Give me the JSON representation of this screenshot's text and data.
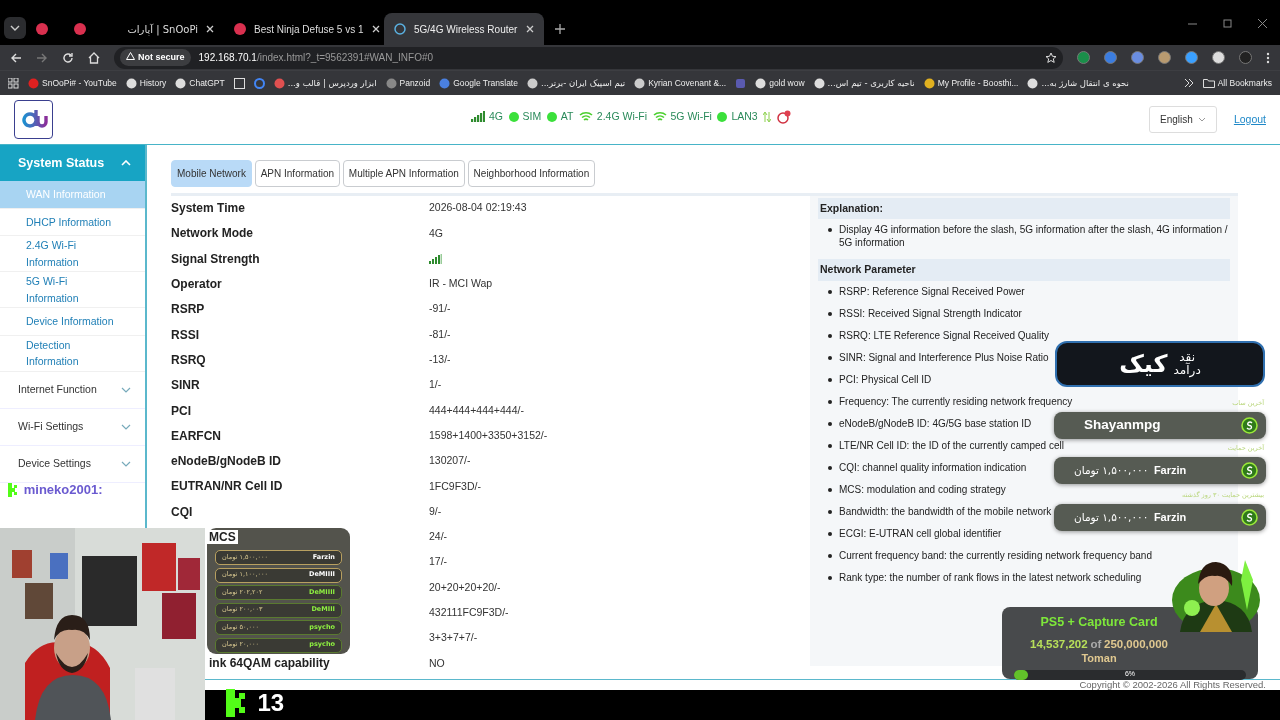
{
  "browser": {
    "tabs": [
      {
        "title": "SnOoPi | آپارات",
        "selected": false
      },
      {
        "title": "Best Ninja Defuse 5 vs 1",
        "selected": false
      },
      {
        "title": "5G/4G Wireless Router",
        "selected": true
      }
    ],
    "security": "Not secure",
    "url_host": "192.168.70.1",
    "url_path": "/index.html?_t=9562391#WAN_INFO#0",
    "bookmarks": [
      "SnOoPi# - YouTube",
      "History",
      "ChatGPT",
      "ابزار وردپرس | قالب و...",
      "Panzoid",
      "Google Translate",
      "تیم اسپیک ایران -برتر...",
      "Kyrian Covenant &...",
      "gold wow",
      "ناحیه کاربری - تیم اس...",
      "My Profile - Boosthi...",
      "نحوه ی انتقال شارژ به..."
    ],
    "all_bookmarks": "All Bookmarks"
  },
  "router": {
    "status": [
      {
        "kind": "signal",
        "label": "4G"
      },
      {
        "kind": "dot",
        "label": "SIM"
      },
      {
        "kind": "dot",
        "label": "AT"
      },
      {
        "kind": "wifi",
        "label": "2.4G Wi-Fi"
      },
      {
        "kind": "wifi",
        "label": "5G Wi-Fi"
      },
      {
        "kind": "dot",
        "label": "LAN3"
      }
    ],
    "language": "English",
    "logout": "Logout",
    "sidebar": [
      {
        "label": "System Status",
        "expanded": true,
        "children": [
          {
            "label": "WAN Information",
            "selected": true
          },
          {
            "label": "DHCP Information",
            "selected": false
          },
          {
            "label": "2.4G Wi-Fi Information",
            "selected": false
          },
          {
            "label": "5G Wi-Fi Information",
            "selected": false
          },
          {
            "label": "Device Information",
            "selected": false
          },
          {
            "label": "Detection Information",
            "selected": false
          }
        ]
      },
      {
        "label": "Internet Function",
        "expanded": false
      },
      {
        "label": "Wi-Fi Settings",
        "expanded": false
      },
      {
        "label": "Device Settings",
        "expanded": false
      }
    ],
    "tabs": [
      {
        "label": "Mobile Network",
        "selected": true
      },
      {
        "label": "APN Information",
        "selected": false
      },
      {
        "label": "Multiple APN Information",
        "selected": false
      },
      {
        "label": "Neighborhood Information",
        "selected": false
      }
    ],
    "rows": [
      {
        "kind": "full",
        "label": "System Time",
        "value": "2026-08-04 02:19:43"
      },
      {
        "kind": "full",
        "label": "Network Mode",
        "value": "4G"
      },
      {
        "kind": "signal",
        "label": "Signal Strength"
      },
      {
        "kind": "full",
        "label": "Operator",
        "value": "IR - MCI Wap"
      },
      {
        "kind": "full",
        "label": "RSRP",
        "value": "-91/-"
      },
      {
        "kind": "full",
        "label": "RSSI",
        "value": "-81/-"
      },
      {
        "kind": "full",
        "label": "RSRQ",
        "value": "-13/-"
      },
      {
        "kind": "full",
        "label": "SINR",
        "value": "1/-"
      },
      {
        "kind": "full",
        "label": "PCI",
        "value": "444+444+444+444/-"
      },
      {
        "kind": "full",
        "label": "EARFCN",
        "value": "1598+1400+3350+3152/-"
      },
      {
        "kind": "full",
        "label": "eNodeB/gNodeB ID",
        "value": "130207/-"
      },
      {
        "kind": "full",
        "label": "EUTRAN/NR Cell ID",
        "value": "1FC9F3D/-"
      },
      {
        "kind": "full",
        "label": "CQI",
        "value": "9/-"
      },
      {
        "kind": "clipped",
        "label": "MCS",
        "value": "24/-"
      },
      {
        "kind": "hidden",
        "value": "17/-"
      },
      {
        "kind": "hidden",
        "value": "20+20+20+20/-"
      },
      {
        "kind": "hidden",
        "value": "432111FC9F3D/-"
      },
      {
        "kind": "hidden",
        "value": "3+3+7+7/-"
      },
      {
        "kind": "clipped",
        "label": "ink 64QAM capability",
        "value": "NO"
      }
    ],
    "explanation_title": "Explanation:",
    "explanation": [
      "Display 4G information before the slash, 5G information after the slash, 4G information / 5G information"
    ],
    "parameter_title": "Network Parameter",
    "parameters": [
      "RSRP: Reference Signal Received Power",
      "RSSI: Received Signal Strength Indicator",
      "RSRQ: LTE Reference Signal Received Quality",
      "SINR: Signal and Interference Plus Noise Ratio",
      "PCI: Physical Cell ID",
      "Frequency: The currently residing network frequency",
      "eNodeB/gNodeB ID: 4G/5G base station ID",
      "LTE/NR Cell ID: the ID of the currently camped cell",
      "CQI: channel quality information indication",
      "MCS: modulation and coding strategy",
      "Bandwidth: the bandwidth of the mobile network",
      "ECGI: E-UTRAN cell global identifier",
      "Current frequency band: the currently residing network frequency band",
      "Rank type: the number of rank flows in the latest network scheduling"
    ],
    "copyright": "Copyright © 2002-2026 All Rights Reserved."
  },
  "stream": {
    "chat_user": "mineko2001:",
    "viewers": "13",
    "donors": [
      {
        "name": "Farzin",
        "amount": "۱,۵۰۰,۰۰۰ تومان"
      },
      {
        "name": "DeMIIII",
        "amount": "۱,۱۰۰,۰۰۰ تومان"
      },
      {
        "name": "DeMIIII",
        "amount": "۲۰۲,۲۰۲ تومان"
      },
      {
        "name": "DeMIII",
        "amount": "۲۰۰,۰۰۳ تومان"
      },
      {
        "name": "psycho",
        "amount": "۵۰,۰۰۰ تومان"
      },
      {
        "name": "psycho",
        "amount": "۲۰,۰۰۰ تومان"
      }
    ],
    "earnings_small": [
      "نقد",
      "درآمد"
    ],
    "earnings_big": "کیک",
    "highlights": [
      {
        "caption": "آخرین ساب",
        "name": "Shayanmpg"
      },
      {
        "caption": "آخرین حمایت",
        "name": "Farzin",
        "amount": "۱,۵۰۰,۰۰۰ تومان"
      },
      {
        "caption": "بیشترین حمایت ۳۰ روز گذشته",
        "name": "Farzin",
        "amount": "۱,۵۰۰,۰۰۰ تومان"
      }
    ],
    "goal": {
      "title": "PS5 + Capture Card",
      "raised": "14,537,202",
      "of": "of",
      "target": "250,000,000",
      "unit": "Toman",
      "level": 0.06,
      "percent": "6%"
    }
  }
}
